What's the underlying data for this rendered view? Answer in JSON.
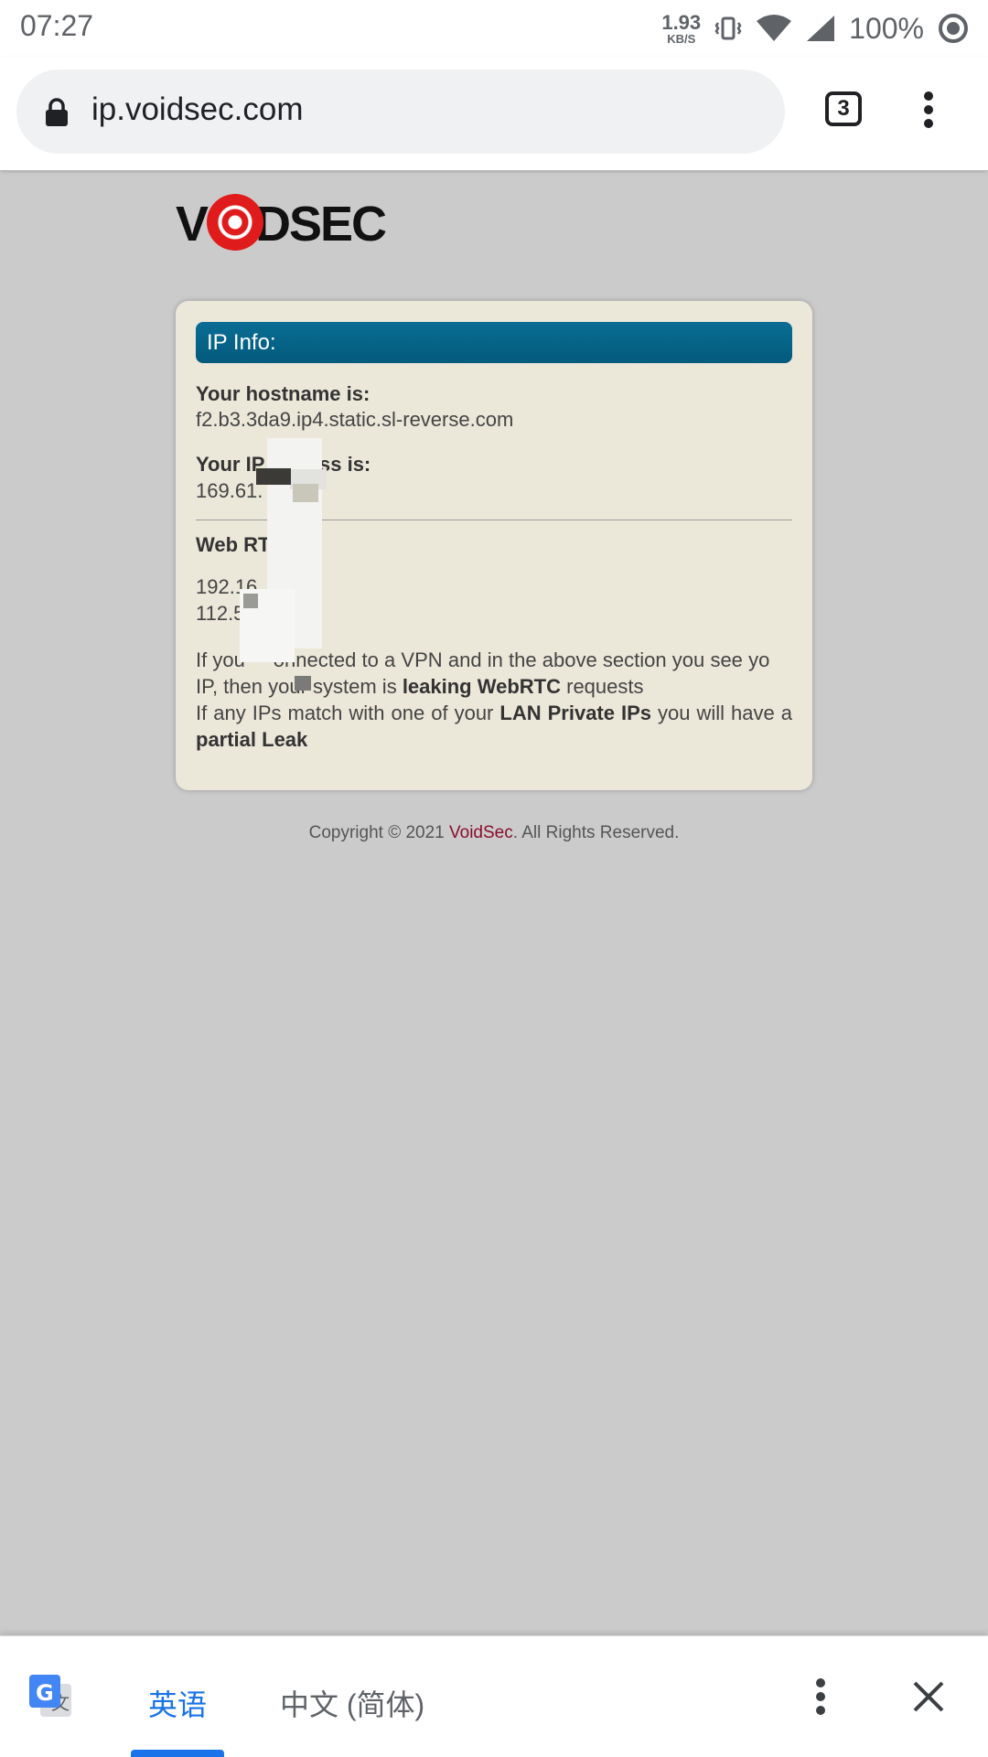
{
  "status_bar": {
    "time": "07:27",
    "speed_value": "1.93",
    "speed_unit": "KB/S",
    "battery": "100%"
  },
  "browser": {
    "url": "ip.voidsec.com",
    "tab_count": "3"
  },
  "logo": {
    "text": "VOIDSEC"
  },
  "card": {
    "header": "IP Info:",
    "hostname_label": "Your hostname is:",
    "hostname_value": "f2.b3.3da9.ip4.static.sl-reverse.com",
    "ip_label": "Your IP address is:",
    "ip_label_visible_left": "Your IP",
    "ip_label_visible_right": "ss is:",
    "ip_value": "169.61.",
    "webrtc_label": "Web RTC",
    "webrtc_ip1": "192.16",
    "webrtc_ip2": "112.50",
    "para1_pre": "If you",
    "para1_mid": "onnected to a VPN and in the above section you see yo",
    "para1_post": " IP, then your system is ",
    "para1_bold": "leaking WebRTC",
    "para1_end": " requests",
    "para2_pre": "If any IPs match with one of your ",
    "para2_bold": "LAN Private IPs",
    "para2_mid": " you will have a ",
    "para2_bold2": "partial Leak"
  },
  "footer": {
    "pre": "Copyright © 2021 ",
    "brand": "VoidSec",
    "post": ". All Rights Reserved."
  },
  "translate_bar": {
    "active_language": "英语",
    "other_language": "中文 (简体)"
  },
  "colors": {
    "page_bg": "#cbcbcb",
    "card_bg": "#ebe7d9",
    "header_bg": "#035a7d",
    "brand": "#8a0d2c",
    "accent": "#1a73e8"
  }
}
